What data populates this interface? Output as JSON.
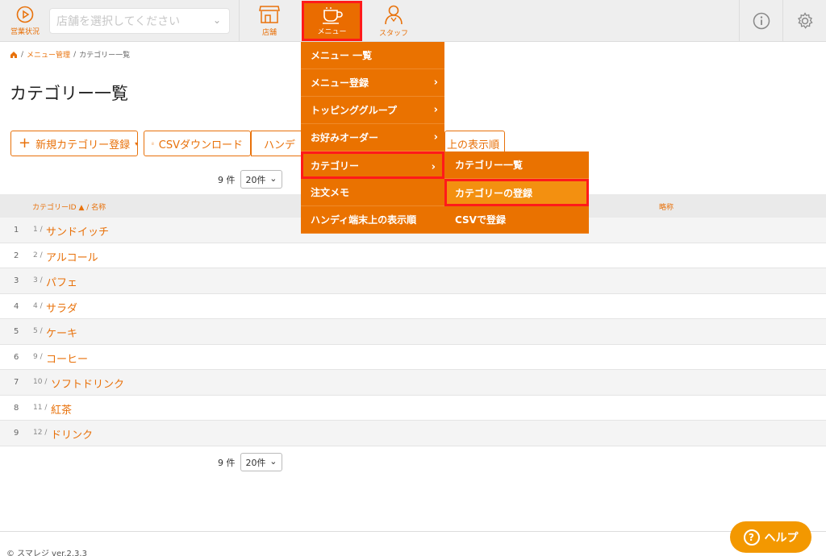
{
  "header": {
    "status_label": "営業状況",
    "store_placeholder": "店舗を選択してください",
    "store_label": "店舗",
    "menu_label": "メニュー",
    "staff_label": "スタッフ"
  },
  "breadcrumb": {
    "menu_mgmt": "メニュー管理",
    "current": "カテゴリー一覧",
    "sep": "/"
  },
  "page": {
    "title": "カテゴリー一覧"
  },
  "toolbar": {
    "new_category": "新規カテゴリー登録",
    "csv_download": "CSVダウンロード",
    "handy_partial": "ハンデ",
    "display_order_partial": "上の表示順"
  },
  "pager": {
    "count": "9 件",
    "per_page": "20件"
  },
  "table": {
    "col_id_name": "カテゴリーID ▲ / 名称",
    "col_short": "略称",
    "rows": [
      {
        "num": "1",
        "id": "1 /",
        "name": "サンドイッチ"
      },
      {
        "num": "2",
        "id": "2 /",
        "name": "アルコール"
      },
      {
        "num": "3",
        "id": "3 /",
        "name": "パフェ"
      },
      {
        "num": "4",
        "id": "4 /",
        "name": "サラダ"
      },
      {
        "num": "5",
        "id": "5 /",
        "name": "ケーキ"
      },
      {
        "num": "6",
        "id": "9 /",
        "name": "コーヒー"
      },
      {
        "num": "7",
        "id": "10 /",
        "name": "ソフトドリンク"
      },
      {
        "num": "8",
        "id": "11 /",
        "name": "紅茶"
      },
      {
        "num": "9",
        "id": "12 /",
        "name": "ドリンク"
      }
    ]
  },
  "dropdown": {
    "items": [
      {
        "label": "メニュー 一覧",
        "has_sub": false
      },
      {
        "label": "メニュー登録",
        "has_sub": true
      },
      {
        "label": "トッピンググループ",
        "has_sub": true
      },
      {
        "label": "お好みオーダー",
        "has_sub": true
      },
      {
        "label": "カテゴリー",
        "has_sub": true
      },
      {
        "label": "注文メモ",
        "has_sub": false
      },
      {
        "label": "ハンディ端末上の表示順",
        "has_sub": false
      }
    ],
    "submenu": [
      {
        "label": "カテゴリー一覧"
      },
      {
        "label": "カテゴリーの登録"
      },
      {
        "label": "CSVで登録"
      }
    ]
  },
  "footer": {
    "copyright": "© スマレジ ver.2.3.3",
    "help": "ヘルプ"
  },
  "colors": {
    "accent": "#e8710a",
    "menu_bg": "#ea7200",
    "highlight_border": "#ff1a1a",
    "help_bg": "#f39800"
  }
}
